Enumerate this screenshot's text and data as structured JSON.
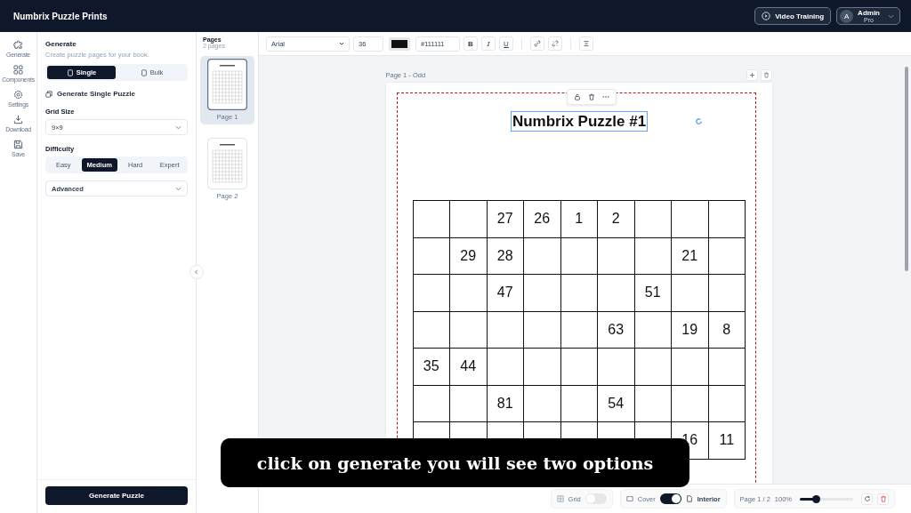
{
  "header": {
    "title": "Numbrix Puzzle Prints",
    "video_training": "Video Training",
    "user": {
      "initial": "A",
      "name": "Admin",
      "plan": "Pro"
    }
  },
  "rail": [
    {
      "kind": "puzzle",
      "label": "Generate"
    },
    {
      "kind": "grid",
      "label": "Components"
    },
    {
      "kind": "gear",
      "label": "Settings"
    },
    {
      "kind": "download",
      "label": "Download"
    },
    {
      "kind": "save",
      "label": "Save"
    }
  ],
  "sidebar": {
    "heading": "Generate",
    "subtitle": "Create puzzle pages for your book.",
    "modes": [
      {
        "label": "Single",
        "selected": true
      },
      {
        "label": "Bulk",
        "selected": false
      }
    ],
    "section_title": "Generate Single Puzzle",
    "grid_size": {
      "label": "Grid Size",
      "value": "9×9"
    },
    "difficulty": {
      "label": "Difficulty",
      "options": [
        {
          "label": "Easy",
          "selected": false
        },
        {
          "label": "Medium",
          "selected": true
        },
        {
          "label": "Hard",
          "selected": false
        },
        {
          "label": "Expert",
          "selected": false
        }
      ]
    },
    "advanced": "Advanced",
    "generate_button": "Generate Puzzle"
  },
  "pages": {
    "title": "Pages",
    "count": "2 pages",
    "items": [
      {
        "label": "Page 1",
        "selected": true
      },
      {
        "label": "Page 2",
        "selected": false
      }
    ]
  },
  "toolbar": {
    "font": "Arial",
    "size": "36",
    "color_hex": "#111111",
    "format_buttons": [
      "B",
      "I",
      "U"
    ]
  },
  "canvas": {
    "page_label": "Page 1 - Odd",
    "title": "Numbrix Puzzle #1",
    "rows": [
      [
        null,
        null,
        "27",
        "26",
        "1",
        "2",
        null,
        null,
        null
      ],
      [
        null,
        "29",
        "28",
        null,
        null,
        null,
        null,
        "21",
        null
      ],
      [
        null,
        null,
        "47",
        null,
        null,
        null,
        "51",
        null,
        null
      ],
      [
        null,
        null,
        null,
        null,
        null,
        "63",
        null,
        "19",
        "8"
      ],
      [
        "35",
        "44",
        null,
        null,
        null,
        null,
        null,
        null,
        null
      ],
      [
        null,
        null,
        "81",
        null,
        null,
        "54",
        null,
        null,
        null
      ],
      [
        null,
        null,
        null,
        null,
        null,
        null,
        null,
        "16",
        "11"
      ]
    ]
  },
  "bottom_bar": {
    "grid_label": "Grid",
    "grid_on": false,
    "cover_label": "Cover",
    "interior_on": true,
    "interior_label": "Interior",
    "page_indicator": "Page 1 / 2",
    "zoom": "100%",
    "zoom_level": {
      "level": 0.3
    }
  },
  "caption": "click on generate you will see two options"
}
